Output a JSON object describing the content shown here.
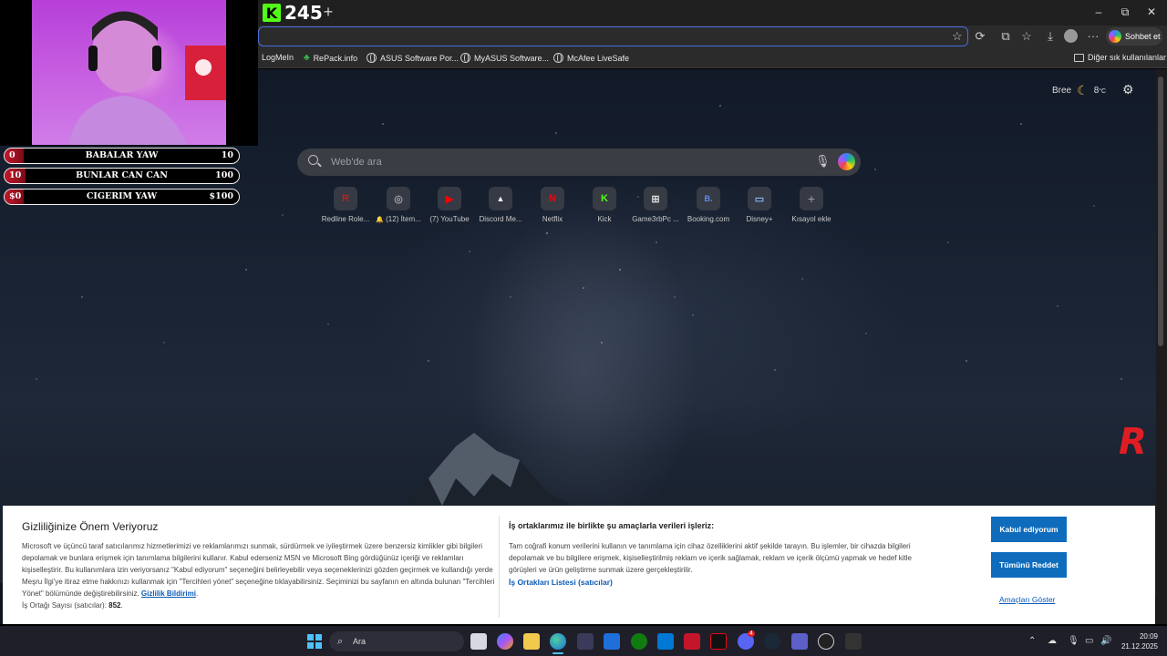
{
  "browser": {
    "kick_logo_letter": "K",
    "tab_count": "245",
    "new_tab_symbol": "+",
    "window_controls": {
      "minimize": "–",
      "restore": "⧉",
      "close": "✕"
    },
    "chat_button_label": "Sohbet et",
    "bookmarks": [
      {
        "label": "LogMeIn",
        "icon": "none"
      },
      {
        "label": "RePack.info",
        "icon": "repack-icon"
      },
      {
        "label": "ASUS Software Por...",
        "icon": "globe-icon"
      },
      {
        "label": "MyASUS Software...",
        "icon": "globe-icon"
      },
      {
        "label": "McAfee LiveSafe",
        "icon": "globe-icon"
      }
    ],
    "other_favorites": "Diğer sık kullanılanlar"
  },
  "ntp": {
    "weather": {
      "location": "Bree",
      "temperature": "8",
      "unit": "°C",
      "icon": "moon-icon"
    },
    "search_placeholder": "Web'de ara",
    "tiles": [
      {
        "label": "Redline Role...",
        "glyph": "R",
        "color": "#b3261e"
      },
      {
        "label": "(12) İtem...",
        "glyph": "◎",
        "color": "#9aa0a6",
        "prefix": "🔔"
      },
      {
        "label": "(7) YouTube",
        "glyph": "▶",
        "color": "#ff0000"
      },
      {
        "label": "Discord Me...",
        "glyph": "▲",
        "color": "#ffffff"
      },
      {
        "label": "Netflix",
        "glyph": "N",
        "color": "#e50914"
      },
      {
        "label": "Kick",
        "glyph": "K",
        "color": "#53fc18"
      },
      {
        "label": "Game3rbPc ...",
        "glyph": "⊞",
        "color": "#dddddd"
      },
      {
        "label": "Booking.com",
        "glyph": "B.",
        "color": "#5b8def"
      },
      {
        "label": "Disney+",
        "glyph": "▭",
        "color": "#8ab4f8"
      },
      {
        "label": "Kısayol ekle",
        "glyph": "+",
        "color": "#9aa0a6"
      }
    ]
  },
  "consent": {
    "title": "Gizliliğinize Önem Veriyoruz",
    "body": "Microsoft ve üçüncü taraf satıcılarımız hizmetlerimizi ve reklamlarımızı sunmak, sürdürmek ve iyileştirmek üzere benzersiz kimlikler gibi bilgileri depolamak ve bunlara erişmek için tanımlama bilgilerini kullanır. Kabul ederseniz MSN ve Microsoft Bing gördüğünüz içeriği ve reklamları kişiselleştirir. Bu kullanımlara izin veriyorsanız \"Kabul ediyorum\" seçeneğini belirleyebilir veya seçeneklerinizi gözden geçirmek ve kullandığı yerde Meşru İlgi'ye itiraz etme hakkınızı kullanmak için \"Tercihleri yönet\" seçeneğine tıklayabilirsiniz. Seçiminizi bu sayfanın en altında bulunan \"Tercihleri Yönet\" bölümünde değiştirebilirsiniz.",
    "privacy_link": "Gizlilik Bildirimi",
    "partner_count_label": "İş Ortağı Sayısı (satıcılar):",
    "partner_count": "852",
    "purposes_title": "İş ortaklarımız ile birlikte şu amaçlarla verileri işleriz:",
    "purposes_body": "Tam coğrafi konum verilerini kullanın ve tanımlama için cihaz özelliklerini aktif şekilde tarayın. Bu işlemler, bir cihazda bilgileri depolamak ve bu bilgilere erişmek, kişiselleştirilmiş reklam ve içerik sağlamak, reklam ve içerik ölçümü yapmak ve hedef kitle görüşleri ve ürün geliştirme sunmak üzere gerçekleştirilir.",
    "partners_list_link": "İş Ortakları Listesi (satıcılar)",
    "accept_label": "Kabul ediyorum",
    "reject_label": "Tümünü Reddet",
    "show_purposes_label": "Amaçları Göster"
  },
  "taskbar": {
    "search_label": "Ara",
    "discord_badge": "4",
    "time": "20:09",
    "date": "21.12.2025"
  },
  "stream_overlay": {
    "poll": [
      {
        "number": "0",
        "name": "BABALAR YAW",
        "value": "10",
        "fill": 0.08
      },
      {
        "number": "10",
        "name": "BUNLAR CAN CAN",
        "value": "100",
        "fill": 0.09
      },
      {
        "number": "$0",
        "name": "CIGERIM YAW",
        "value": "$100",
        "fill": 0.08
      }
    ],
    "corner_logo": "R",
    "brand_red": "#e11d24"
  }
}
